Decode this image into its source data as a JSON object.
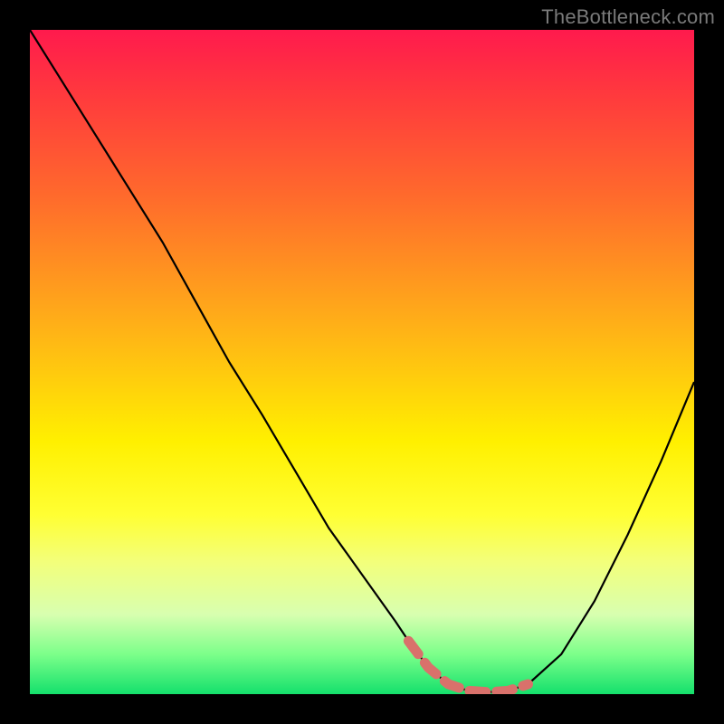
{
  "watermark": "TheBottleneck.com",
  "colors": {
    "background": "#000000",
    "curve_stroke": "#000000",
    "highlight_stroke": "#d9716b",
    "gradient_top": "#ff1a4d",
    "gradient_bottom": "#14e06c"
  },
  "chart_data": {
    "type": "line",
    "title": "",
    "xlabel": "",
    "ylabel": "",
    "xlim": [
      0,
      100
    ],
    "ylim": [
      0,
      100
    ],
    "grid": false,
    "legend": false,
    "annotations": [],
    "series": [
      {
        "name": "bottleneck-percent",
        "x": [
          0,
          5,
          10,
          15,
          20,
          25,
          30,
          35,
          40,
          45,
          50,
          55,
          57,
          60,
          63,
          66,
          69,
          72,
          75,
          80,
          85,
          90,
          95,
          100
        ],
        "values": [
          100,
          92,
          84,
          76,
          68,
          59,
          50,
          42,
          33.5,
          25,
          18,
          11,
          8,
          4,
          1.5,
          0.5,
          0.3,
          0.5,
          1.5,
          6,
          14,
          24,
          35,
          47
        ]
      }
    ],
    "highlight": {
      "name": "optimal-range",
      "x": [
        57,
        60,
        63,
        66,
        69,
        72,
        75
      ],
      "values": [
        8,
        4,
        1.5,
        0.5,
        0.3,
        0.5,
        1.5
      ]
    }
  }
}
